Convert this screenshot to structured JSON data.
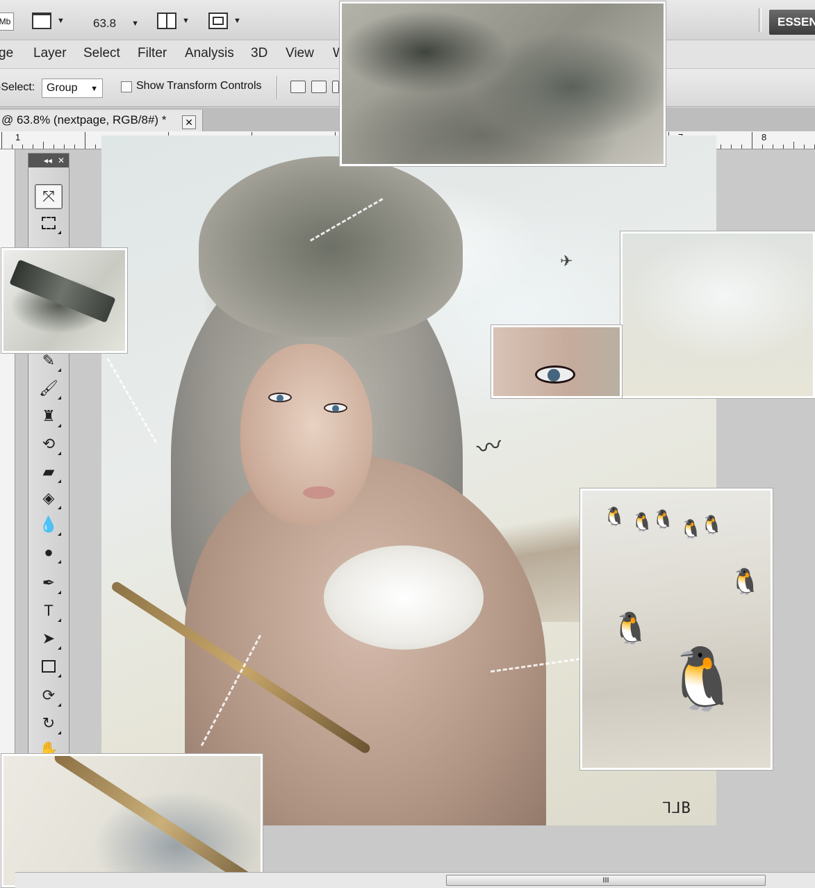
{
  "appbar": {
    "mb_badge": "Mb",
    "zoom_value": "63.8",
    "workspace_button": "ESSENTIALS"
  },
  "menu": {
    "items": [
      "ge",
      "Layer",
      "Select",
      "Filter",
      "Analysis",
      "3D",
      "View",
      "W"
    ]
  },
  "options": {
    "auto_select_label": "-Select:",
    "auto_select_value": "Group",
    "show_transform_label": "Show Transform Controls"
  },
  "document": {
    "tab_title": "@ 63.8% (nextpage, RGB/8#) *",
    "close_symbol": "✕"
  },
  "ruler": {
    "labels": [
      "1",
      "7",
      "8"
    ]
  },
  "toolbox": {
    "collapse_symbol": "◂◂",
    "close_symbol": "✕",
    "active_tool": "move-tool"
  },
  "artwork": {
    "signature": "⅂⅃B"
  },
  "scrollbar": {
    "grip": "III"
  }
}
